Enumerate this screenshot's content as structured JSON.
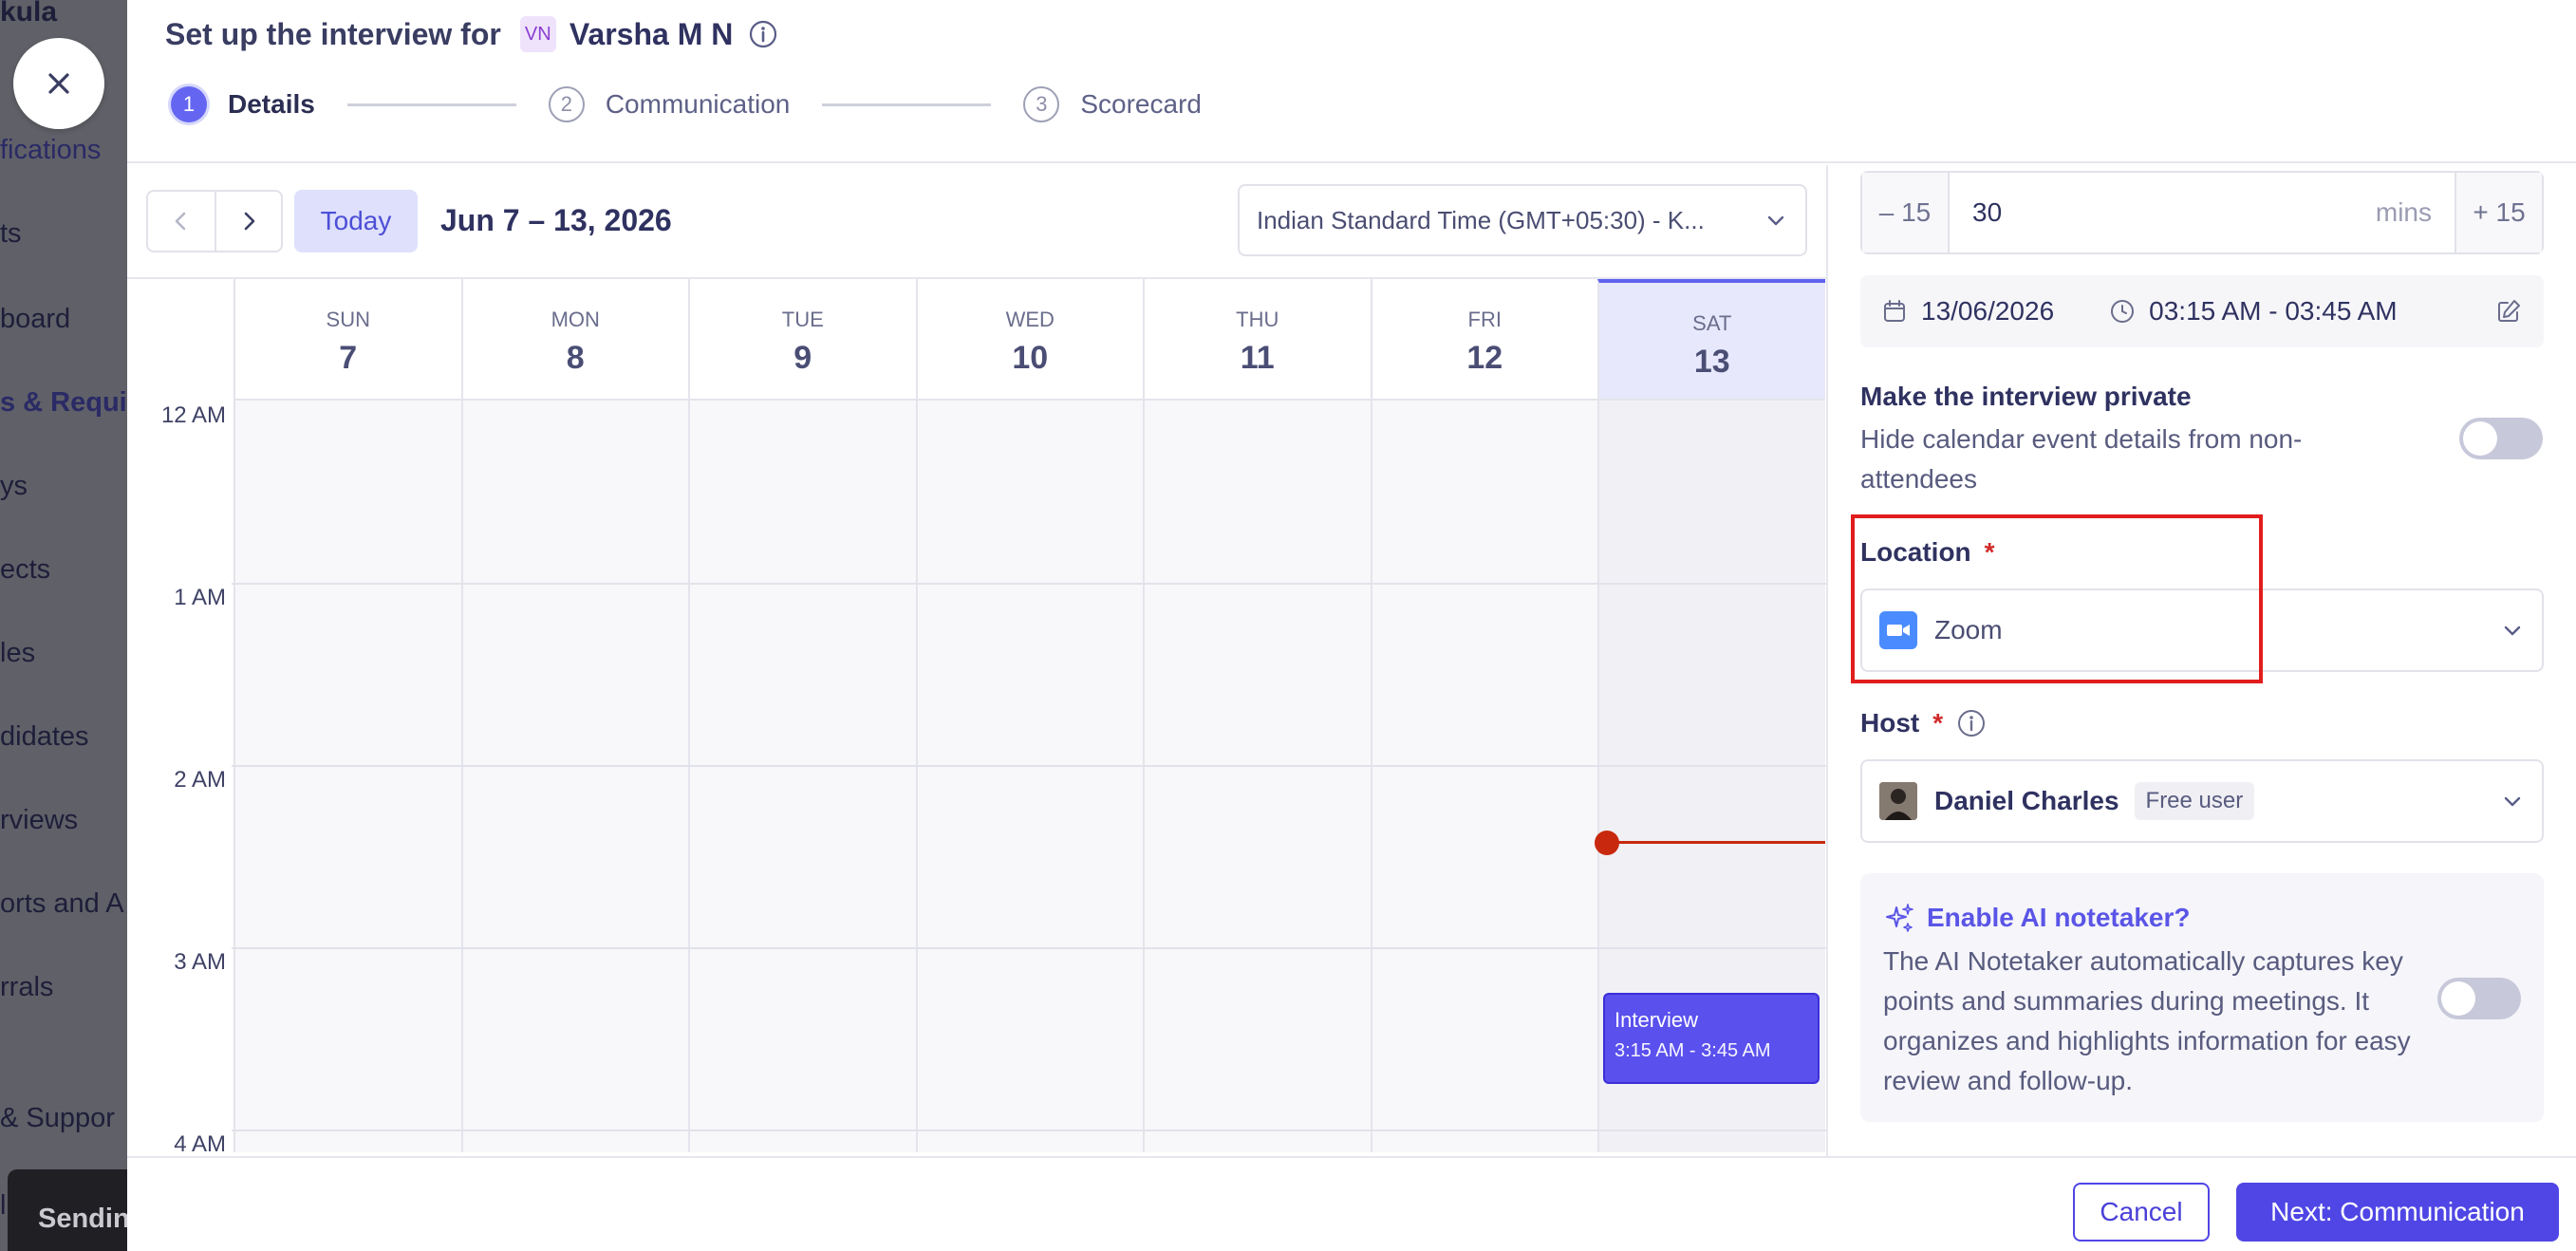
{
  "background": {
    "brand": "kula",
    "nav_items": [
      "fications",
      "ts",
      "board",
      "s & Requis",
      "ys",
      "ects",
      "les",
      "didates",
      "rviews",
      "orts and A",
      "rrals",
      "& Suppor"
    ],
    "toast": "Sendin",
    "footer_letter": "l"
  },
  "modal": {
    "title": "Set up the interview for",
    "candidate_initials": "VN",
    "candidate_name": "Varsha M N",
    "steps": [
      {
        "num": "1",
        "label": "Details",
        "active": true
      },
      {
        "num": "2",
        "label": "Communication",
        "active": false
      },
      {
        "num": "3",
        "label": "Scorecard",
        "active": false
      }
    ]
  },
  "calendar": {
    "today_label": "Today",
    "range": "Jun 7 – 13, 2026",
    "timezone": "Indian Standard Time (GMT+05:30) - K...",
    "days": [
      {
        "dow": "SUN",
        "dom": "7"
      },
      {
        "dow": "MON",
        "dom": "8"
      },
      {
        "dow": "TUE",
        "dom": "9"
      },
      {
        "dow": "WED",
        "dom": "10"
      },
      {
        "dow": "THU",
        "dom": "11"
      },
      {
        "dow": "FRI",
        "dom": "12"
      },
      {
        "dow": "SAT",
        "dom": "13"
      }
    ],
    "selected_day": "13",
    "hours": [
      "12 AM",
      "1 AM",
      "2 AM",
      "3 AM",
      "4 AM"
    ],
    "event": {
      "title": "Interview",
      "time": "3:15 AM - 3:45 AM"
    }
  },
  "details": {
    "duration_minus": "– 15",
    "duration_value": "30",
    "duration_unit": "mins",
    "duration_plus": "+ 15",
    "date": "13/06/2026",
    "time_range": "03:15 AM - 03:45 AM",
    "private": {
      "title": "Make the interview private",
      "description": "Hide calendar event details from non-attendees",
      "enabled": false
    },
    "location": {
      "label": "Location",
      "required_mark": "*",
      "value": "Zoom"
    },
    "host": {
      "label": "Host",
      "required_mark": "*",
      "name": "Daniel Charles",
      "badge": "Free user"
    },
    "ai_notetaker": {
      "title": "Enable AI notetaker?",
      "description": "The AI Notetaker automatically captures key points and summaries during meetings. It organizes and highlights information for easy review and follow-up.",
      "enabled": false
    }
  },
  "footer": {
    "cancel": "Cancel",
    "next": "Next: Communication"
  },
  "colors": {
    "accent": "#4f46e5",
    "event": "#5a50ee",
    "now_line": "#c8290e",
    "highlight": "#e11d1d",
    "zoom": "#4a8cff"
  }
}
